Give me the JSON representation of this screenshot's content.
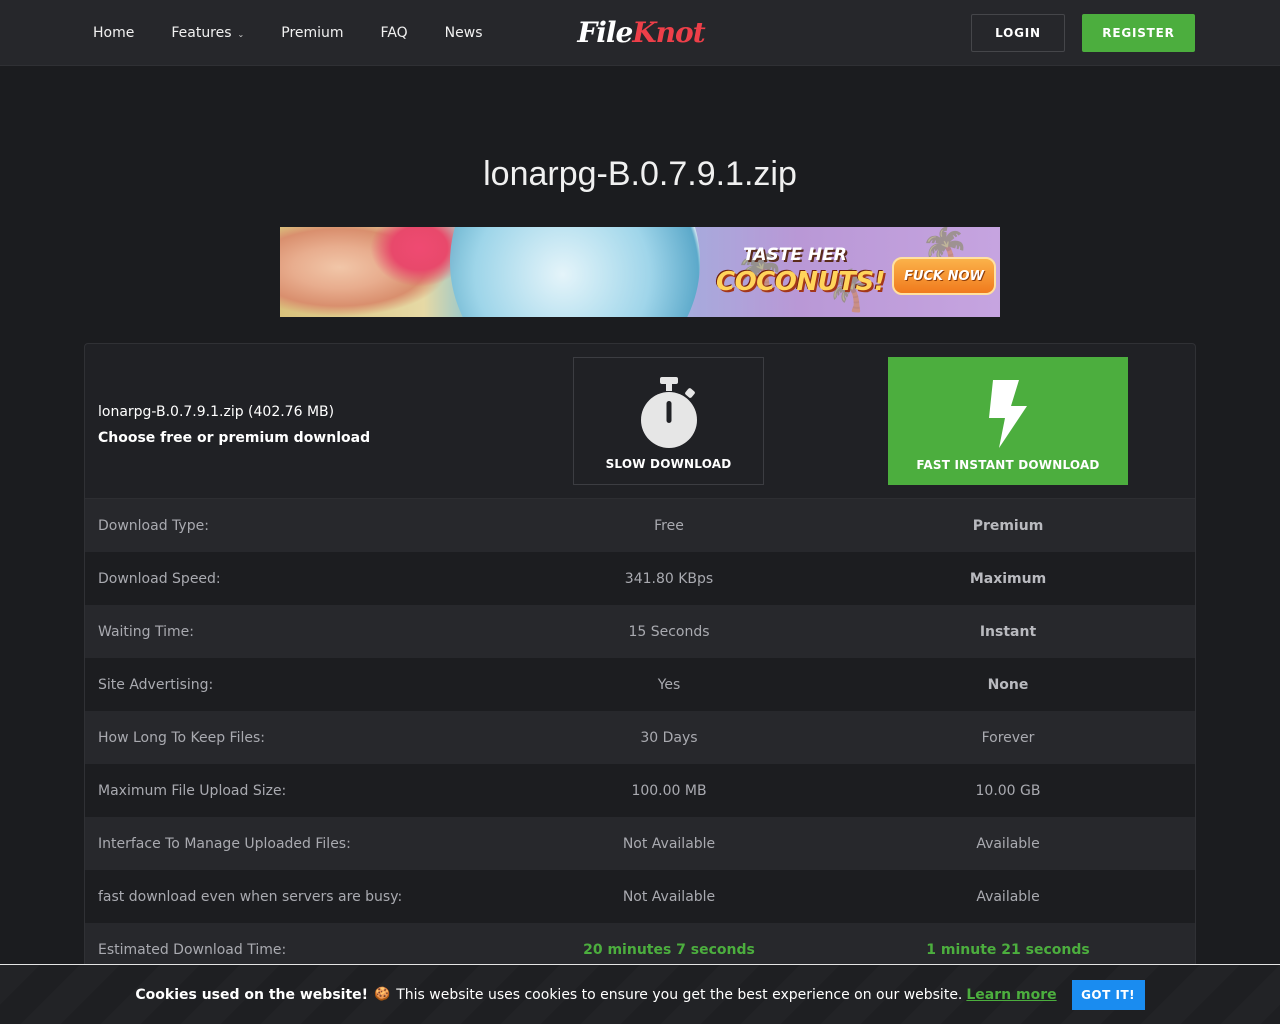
{
  "nav": {
    "items": [
      {
        "label": "Home"
      },
      {
        "label": "Features",
        "has_dropdown": true
      },
      {
        "label": "Premium"
      },
      {
        "label": "FAQ"
      },
      {
        "label": "News"
      }
    ],
    "logo": {
      "part1": "File",
      "part2": "Knot"
    },
    "login_label": "LOGIN",
    "register_label": "REGISTER"
  },
  "page": {
    "title": "lonarpg-B.0.7.9.1.zip"
  },
  "banner": {
    "headline_small": "TASTE HER",
    "headline_big": "COCONUTS!",
    "cta_label": "FUCK NOW"
  },
  "download": {
    "file_line": "lonarpg-B.0.7.9.1.zip (402.76 MB)",
    "subtitle": "Choose free or premium download",
    "slow_label": "SLOW DOWNLOAD",
    "fast_label": "FAST INSTANT DOWNLOAD",
    "slow_icon": "stopwatch-icon",
    "fast_icon": "lightning-bolt-icon"
  },
  "comparison": [
    {
      "label": "Download Type:",
      "free": "Free",
      "premium": "Premium"
    },
    {
      "label": "Download Speed:",
      "free": "341.80 KBps",
      "premium": "Maximum"
    },
    {
      "label": "Waiting Time:",
      "free": "15 Seconds",
      "premium": "Instant"
    },
    {
      "label": "Site Advertising:",
      "free": "Yes",
      "premium": "None"
    },
    {
      "label": "How Long To Keep Files:",
      "free": "30 Days",
      "premium": "Forever"
    },
    {
      "label": "Maximum File Upload Size:",
      "free": "100.00 MB",
      "premium": "10.00 GB"
    },
    {
      "label": "Interface To Manage Uploaded Files:",
      "free": "Not Available",
      "premium": "Available"
    },
    {
      "label": "fast download even when servers are busy:",
      "free": "Not Available",
      "premium": "Available"
    },
    {
      "label": "Estimated Download Time:",
      "free": "20 minutes 7 seconds",
      "premium": "1 minute 21 seconds"
    }
  ],
  "cookie": {
    "heading": "Cookies used on the website!",
    "message": "This website uses cookies to ensure you get the best experience on our website.",
    "learn_more": "Learn more",
    "button": "GOT IT!"
  },
  "colors": {
    "accent_green": "#4cae3e",
    "logo_red": "#ee3f49",
    "cookie_button": "#1a8cf0",
    "background": "#1b1c1f"
  }
}
